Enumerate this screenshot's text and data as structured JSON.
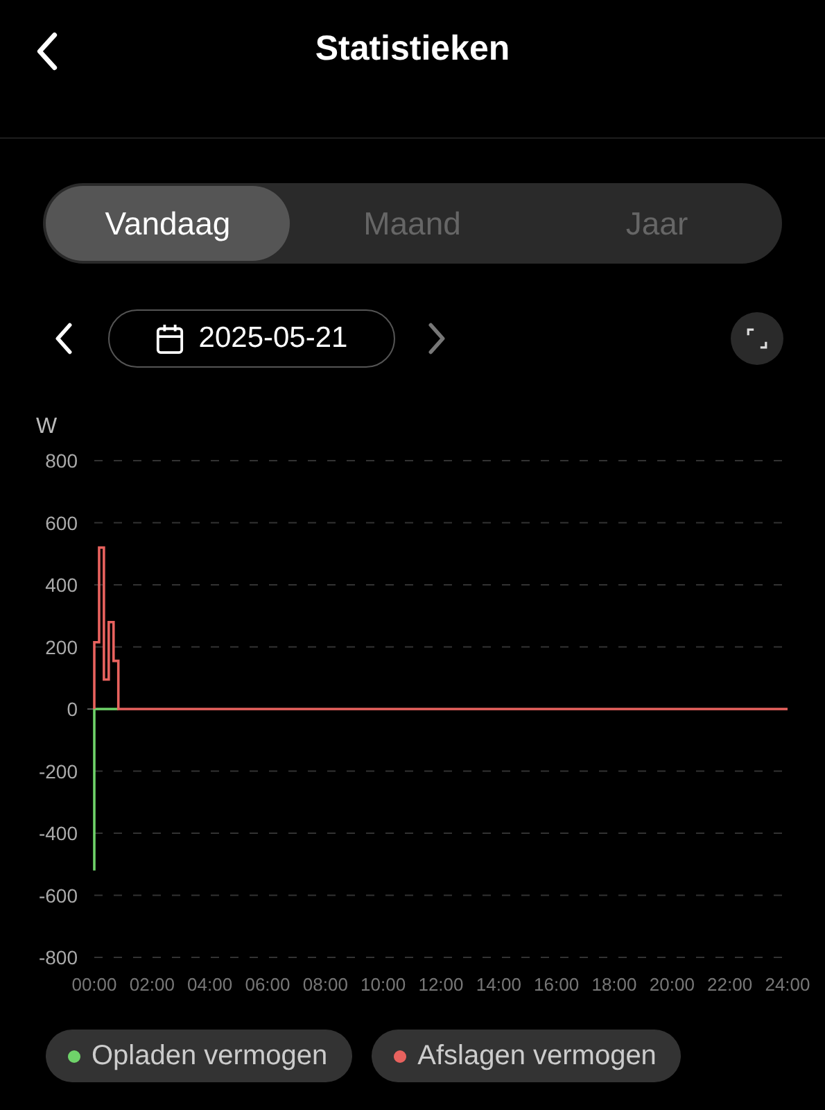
{
  "header": {
    "title": "Statistieken"
  },
  "tabs": [
    {
      "label": "Vandaag",
      "selected": true
    },
    {
      "label": "Maand",
      "selected": false
    },
    {
      "label": "Jaar",
      "selected": false
    }
  ],
  "date": {
    "value": "2025-05-21"
  },
  "chart": {
    "chart_data": {
      "type": "line",
      "ylabel": "W",
      "x": [
        0,
        0,
        0.167,
        0.167,
        0.333,
        0.333,
        0.5,
        0.5,
        0.667,
        0.667,
        0.833,
        0.833,
        24
      ],
      "xlim": [
        0,
        24
      ],
      "ylim": [
        -800,
        800
      ],
      "grid": true,
      "xticks": [
        {
          "value": 0,
          "label": "00:00"
        },
        {
          "value": 2,
          "label": "02:00"
        },
        {
          "value": 4,
          "label": "04:00"
        },
        {
          "value": 6,
          "label": "06:00"
        },
        {
          "value": 8,
          "label": "08:00"
        },
        {
          "value": 10,
          "label": "10:00"
        },
        {
          "value": 12,
          "label": "12:00"
        },
        {
          "value": 14,
          "label": "14:00"
        },
        {
          "value": 16,
          "label": "16:00"
        },
        {
          "value": 18,
          "label": "18:00"
        },
        {
          "value": 20,
          "label": "20:00"
        },
        {
          "value": 22,
          "label": "22:00"
        },
        {
          "value": 24,
          "label": "24:00"
        }
      ],
      "yticks": [
        -800,
        -600,
        -400,
        -200,
        0,
        200,
        400,
        600,
        800
      ],
      "series": [
        {
          "name": "Opladen vermogen",
          "color": "#6fd36a",
          "values": [
            -520,
            0,
            0,
            0,
            0,
            0,
            0,
            0,
            0,
            0,
            0,
            0,
            null
          ]
        },
        {
          "name": "Afslagen vermogen",
          "color": "#e8625e",
          "values": [
            0,
            215,
            215,
            520,
            520,
            95,
            95,
            280,
            280,
            155,
            155,
            0,
            0
          ]
        }
      ]
    }
  }
}
